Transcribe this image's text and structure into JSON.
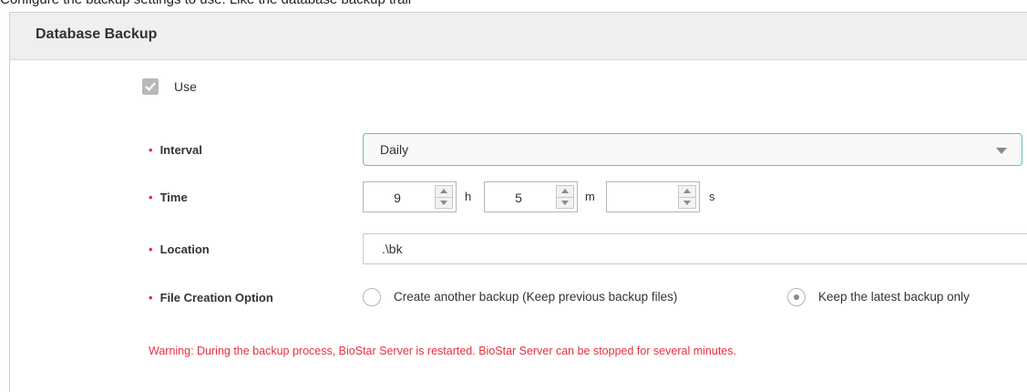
{
  "intro_text": "Configure the backup settings to use.  Like the database backup trail",
  "panel": {
    "title": "Database Backup"
  },
  "use": {
    "label": "Use",
    "checked": true
  },
  "interval": {
    "label": "Interval",
    "value": "Daily"
  },
  "time": {
    "label": "Time",
    "hours": "9",
    "hours_unit": "h",
    "minutes": "5",
    "minutes_unit": "m",
    "seconds": "",
    "seconds_unit": "s"
  },
  "location": {
    "label": "Location",
    "value": ".\\bk"
  },
  "file_creation": {
    "label": "File Creation Option",
    "option_1": "Create another backup (Keep previous backup files)",
    "option_2": "Keep the latest backup only",
    "selected": "option_2"
  },
  "required_marker": "•",
  "warning": "Warning: During the backup process, BioStar Server is restarted. BioStar Server can be stopped for several minutes.",
  "colors": {
    "required": "#e8303f",
    "warning": "#e8303f",
    "focus_border": "#6fb8b8"
  }
}
